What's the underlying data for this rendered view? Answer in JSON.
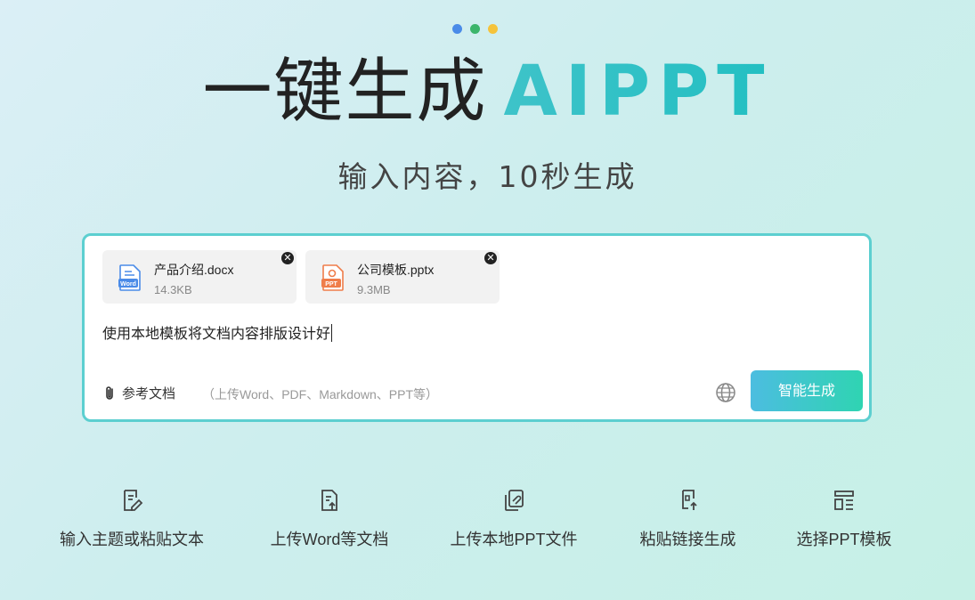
{
  "colors": {
    "dot1": "#4a8be8",
    "dot2": "#3cb56b",
    "dot3": "#f5c33b",
    "accent": "#2bc0c4",
    "button_from": "#4cbde0",
    "button_to": "#2fd4b2"
  },
  "title": {
    "main": "一键生成",
    "accent": "AIPPT"
  },
  "subtitle": "输入内容，10秒生成",
  "files": [
    {
      "name": "产品介绍.docx",
      "size": "14.3KB",
      "icon": "word-file-icon",
      "badge": "Word"
    },
    {
      "name": "公司模板.pptx",
      "size": "9.3MB",
      "icon": "ppt-file-icon",
      "badge": "PPT"
    }
  ],
  "prompt_text": "使用本地模板将文档内容排版设计好",
  "attach": {
    "label": "参考文档",
    "hint": "（上传Word、PDF、Markdown、PPT等）"
  },
  "generate_button": "智能生成",
  "features": [
    {
      "label": "输入主题或粘贴文本",
      "icon": "edit-document-icon"
    },
    {
      "label": "上传Word等文档",
      "icon": "upload-document-icon"
    },
    {
      "label": "上传本地PPT文件",
      "icon": "upload-ppt-icon"
    },
    {
      "label": "粘贴链接生成",
      "icon": "paste-link-icon"
    },
    {
      "label": "选择PPT模板",
      "icon": "template-layout-icon"
    }
  ]
}
